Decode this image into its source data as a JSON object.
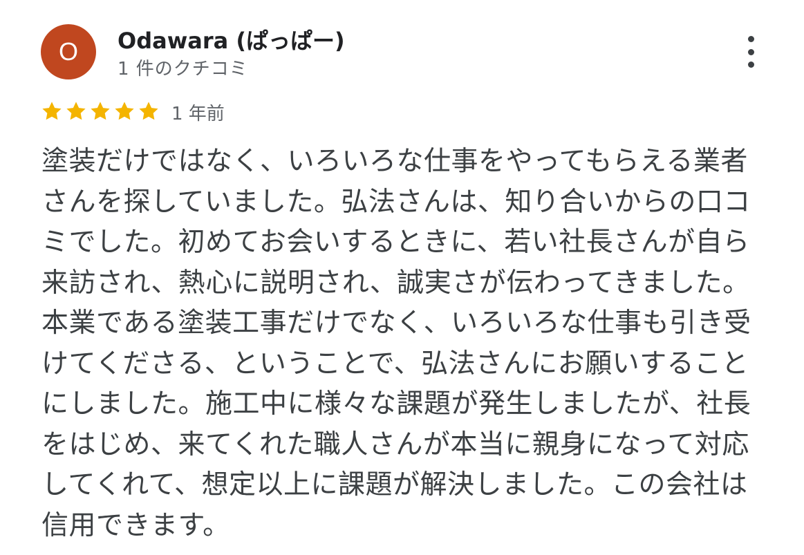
{
  "reviewer": {
    "avatar_letter": "O",
    "avatar_color": "#c0471f",
    "name": "Odawara (ぱっぱー)",
    "review_count": "1 件のクチコミ"
  },
  "more_icon": "more-vert-icon",
  "rating": {
    "stars": 5,
    "max": 5,
    "star_color": "#f4b400",
    "star_icon": "star-icon",
    "time": "1 年前"
  },
  "review": {
    "lines": [
      "塗装だけではなく、いろいろな仕事をやってもらえる業者",
      "さんを探していました。弘法さんは、知り合いからの口コ",
      "ミでした。初めてお会いするときに、若い社長さんが自ら",
      "来訪され、熱心に説明され、誠実さが伝わってきました。",
      "本業である塗装工事だけでなく、いろいろな仕事も引き受",
      "けてくださる、ということで、弘法さんにお願いすること",
      "にしました。施工中に様々な課題が発生しましたが、社長",
      "をはじめ、来てくれた職人さんが本当に親身になって対応",
      "してくれて、想定以上に課題が解決しました。この会社は",
      "信用できます。"
    ]
  }
}
